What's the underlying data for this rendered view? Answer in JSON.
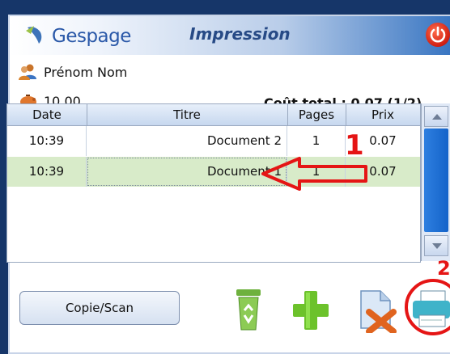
{
  "header": {
    "logo_text": "Gespage",
    "title": "Impression"
  },
  "user": {
    "name": "Prénom Nom",
    "balance": "10.00"
  },
  "summary": {
    "cost_total": "Coût total : 0.07  (1/2)"
  },
  "table": {
    "columns": [
      "Date",
      "Titre",
      "Pages",
      "Prix"
    ],
    "rows": [
      {
        "date": "10:39",
        "title": "Document 2",
        "pages": "1",
        "prix": "0.07",
        "selected": false
      },
      {
        "date": "10:39",
        "title": "Document 1",
        "pages": "1",
        "prix": "0.07",
        "selected": true
      }
    ]
  },
  "buttons": {
    "copy_scan": "Copie/Scan"
  },
  "annotations": {
    "num1": "1",
    "num2": "2"
  },
  "icons": {
    "logo": "gespage-logo-icon",
    "power": "power-icon",
    "user": "user-icon",
    "wallet": "piggy-bank-icon",
    "trash": "recycle-bin-icon",
    "add": "plus-icon",
    "delete_doc": "delete-document-icon",
    "print": "printer-icon"
  },
  "colors": {
    "background": "#163669",
    "accent_blue": "#2f6fbf",
    "selected_row": "#d8ebc9",
    "annotation_red": "#e51515"
  }
}
